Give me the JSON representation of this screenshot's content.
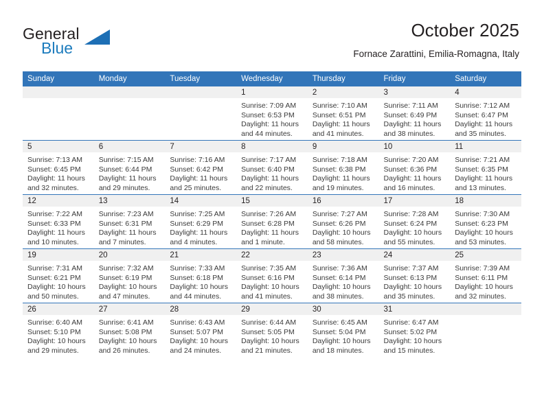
{
  "brand": {
    "name_part1": "General",
    "name_part2": "Blue",
    "logo_icon": "triangle-logo-icon",
    "accent_color": "#1d6fb5"
  },
  "header": {
    "title": "October 2025",
    "subtitle": "Fornace Zarattini, Emilia-Romagna, Italy"
  },
  "calendar": {
    "header_bg": "#3275b9",
    "daynum_bg": "#f0f0f0",
    "weekday_headers": [
      "Sunday",
      "Monday",
      "Tuesday",
      "Wednesday",
      "Thursday",
      "Friday",
      "Saturday"
    ],
    "weeks": [
      [
        {
          "day": "",
          "empty": true
        },
        {
          "day": "",
          "empty": true
        },
        {
          "day": "",
          "empty": true
        },
        {
          "day": "1",
          "sunrise": "Sunrise: 7:09 AM",
          "sunset": "Sunset: 6:53 PM",
          "daylight_l1": "Daylight: 11 hours",
          "daylight_l2": "and 44 minutes."
        },
        {
          "day": "2",
          "sunrise": "Sunrise: 7:10 AM",
          "sunset": "Sunset: 6:51 PM",
          "daylight_l1": "Daylight: 11 hours",
          "daylight_l2": "and 41 minutes."
        },
        {
          "day": "3",
          "sunrise": "Sunrise: 7:11 AM",
          "sunset": "Sunset: 6:49 PM",
          "daylight_l1": "Daylight: 11 hours",
          "daylight_l2": "and 38 minutes."
        },
        {
          "day": "4",
          "sunrise": "Sunrise: 7:12 AM",
          "sunset": "Sunset: 6:47 PM",
          "daylight_l1": "Daylight: 11 hours",
          "daylight_l2": "and 35 minutes."
        }
      ],
      [
        {
          "day": "5",
          "sunrise": "Sunrise: 7:13 AM",
          "sunset": "Sunset: 6:45 PM",
          "daylight_l1": "Daylight: 11 hours",
          "daylight_l2": "and 32 minutes."
        },
        {
          "day": "6",
          "sunrise": "Sunrise: 7:15 AM",
          "sunset": "Sunset: 6:44 PM",
          "daylight_l1": "Daylight: 11 hours",
          "daylight_l2": "and 29 minutes."
        },
        {
          "day": "7",
          "sunrise": "Sunrise: 7:16 AM",
          "sunset": "Sunset: 6:42 PM",
          "daylight_l1": "Daylight: 11 hours",
          "daylight_l2": "and 25 minutes."
        },
        {
          "day": "8",
          "sunrise": "Sunrise: 7:17 AM",
          "sunset": "Sunset: 6:40 PM",
          "daylight_l1": "Daylight: 11 hours",
          "daylight_l2": "and 22 minutes."
        },
        {
          "day": "9",
          "sunrise": "Sunrise: 7:18 AM",
          "sunset": "Sunset: 6:38 PM",
          "daylight_l1": "Daylight: 11 hours",
          "daylight_l2": "and 19 minutes."
        },
        {
          "day": "10",
          "sunrise": "Sunrise: 7:20 AM",
          "sunset": "Sunset: 6:36 PM",
          "daylight_l1": "Daylight: 11 hours",
          "daylight_l2": "and 16 minutes."
        },
        {
          "day": "11",
          "sunrise": "Sunrise: 7:21 AM",
          "sunset": "Sunset: 6:35 PM",
          "daylight_l1": "Daylight: 11 hours",
          "daylight_l2": "and 13 minutes."
        }
      ],
      [
        {
          "day": "12",
          "sunrise": "Sunrise: 7:22 AM",
          "sunset": "Sunset: 6:33 PM",
          "daylight_l1": "Daylight: 11 hours",
          "daylight_l2": "and 10 minutes."
        },
        {
          "day": "13",
          "sunrise": "Sunrise: 7:23 AM",
          "sunset": "Sunset: 6:31 PM",
          "daylight_l1": "Daylight: 11 hours",
          "daylight_l2": "and 7 minutes."
        },
        {
          "day": "14",
          "sunrise": "Sunrise: 7:25 AM",
          "sunset": "Sunset: 6:29 PM",
          "daylight_l1": "Daylight: 11 hours",
          "daylight_l2": "and 4 minutes."
        },
        {
          "day": "15",
          "sunrise": "Sunrise: 7:26 AM",
          "sunset": "Sunset: 6:28 PM",
          "daylight_l1": "Daylight: 11 hours",
          "daylight_l2": "and 1 minute."
        },
        {
          "day": "16",
          "sunrise": "Sunrise: 7:27 AM",
          "sunset": "Sunset: 6:26 PM",
          "daylight_l1": "Daylight: 10 hours",
          "daylight_l2": "and 58 minutes."
        },
        {
          "day": "17",
          "sunrise": "Sunrise: 7:28 AM",
          "sunset": "Sunset: 6:24 PM",
          "daylight_l1": "Daylight: 10 hours",
          "daylight_l2": "and 55 minutes."
        },
        {
          "day": "18",
          "sunrise": "Sunrise: 7:30 AM",
          "sunset": "Sunset: 6:23 PM",
          "daylight_l1": "Daylight: 10 hours",
          "daylight_l2": "and 53 minutes."
        }
      ],
      [
        {
          "day": "19",
          "sunrise": "Sunrise: 7:31 AM",
          "sunset": "Sunset: 6:21 PM",
          "daylight_l1": "Daylight: 10 hours",
          "daylight_l2": "and 50 minutes."
        },
        {
          "day": "20",
          "sunrise": "Sunrise: 7:32 AM",
          "sunset": "Sunset: 6:19 PM",
          "daylight_l1": "Daylight: 10 hours",
          "daylight_l2": "and 47 minutes."
        },
        {
          "day": "21",
          "sunrise": "Sunrise: 7:33 AM",
          "sunset": "Sunset: 6:18 PM",
          "daylight_l1": "Daylight: 10 hours",
          "daylight_l2": "and 44 minutes."
        },
        {
          "day": "22",
          "sunrise": "Sunrise: 7:35 AM",
          "sunset": "Sunset: 6:16 PM",
          "daylight_l1": "Daylight: 10 hours",
          "daylight_l2": "and 41 minutes."
        },
        {
          "day": "23",
          "sunrise": "Sunrise: 7:36 AM",
          "sunset": "Sunset: 6:14 PM",
          "daylight_l1": "Daylight: 10 hours",
          "daylight_l2": "and 38 minutes."
        },
        {
          "day": "24",
          "sunrise": "Sunrise: 7:37 AM",
          "sunset": "Sunset: 6:13 PM",
          "daylight_l1": "Daylight: 10 hours",
          "daylight_l2": "and 35 minutes."
        },
        {
          "day": "25",
          "sunrise": "Sunrise: 7:39 AM",
          "sunset": "Sunset: 6:11 PM",
          "daylight_l1": "Daylight: 10 hours",
          "daylight_l2": "and 32 minutes."
        }
      ],
      [
        {
          "day": "26",
          "sunrise": "Sunrise: 6:40 AM",
          "sunset": "Sunset: 5:10 PM",
          "daylight_l1": "Daylight: 10 hours",
          "daylight_l2": "and 29 minutes."
        },
        {
          "day": "27",
          "sunrise": "Sunrise: 6:41 AM",
          "sunset": "Sunset: 5:08 PM",
          "daylight_l1": "Daylight: 10 hours",
          "daylight_l2": "and 26 minutes."
        },
        {
          "day": "28",
          "sunrise": "Sunrise: 6:43 AM",
          "sunset": "Sunset: 5:07 PM",
          "daylight_l1": "Daylight: 10 hours",
          "daylight_l2": "and 24 minutes."
        },
        {
          "day": "29",
          "sunrise": "Sunrise: 6:44 AM",
          "sunset": "Sunset: 5:05 PM",
          "daylight_l1": "Daylight: 10 hours",
          "daylight_l2": "and 21 minutes."
        },
        {
          "day": "30",
          "sunrise": "Sunrise: 6:45 AM",
          "sunset": "Sunset: 5:04 PM",
          "daylight_l1": "Daylight: 10 hours",
          "daylight_l2": "and 18 minutes."
        },
        {
          "day": "31",
          "sunrise": "Sunrise: 6:47 AM",
          "sunset": "Sunset: 5:02 PM",
          "daylight_l1": "Daylight: 10 hours",
          "daylight_l2": "and 15 minutes."
        },
        {
          "day": "",
          "empty": true
        }
      ]
    ]
  }
}
